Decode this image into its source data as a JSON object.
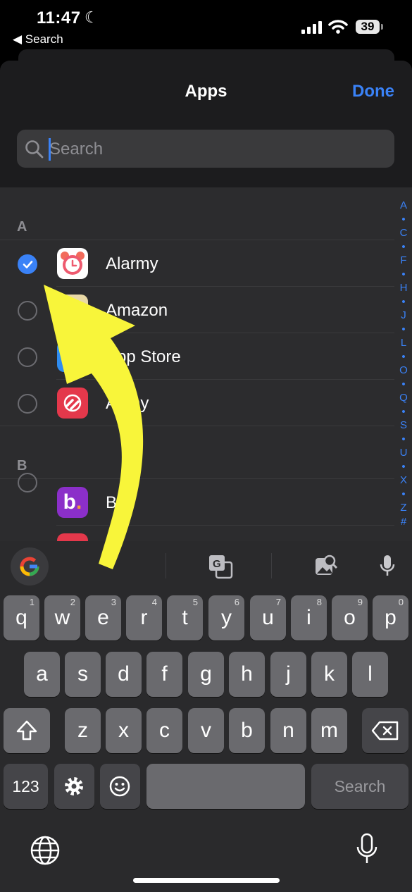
{
  "status_bar": {
    "time": "11:47",
    "back_label": "Search",
    "battery": "39"
  },
  "header": {
    "title": "Apps",
    "done_label": "Done"
  },
  "search": {
    "placeholder": "Search"
  },
  "sections": [
    {
      "letter": "A",
      "apps": [
        {
          "name": "Alarmy",
          "selected": true
        },
        {
          "name": "Amazon",
          "selected": false
        },
        {
          "name": "App Store",
          "selected": false
        },
        {
          "name": "Authy",
          "selected": false
        }
      ]
    },
    {
      "letter": "B",
      "apps": [
        {
          "name": "BN",
          "selected": false
        }
      ]
    }
  ],
  "index_letters": [
    "A",
    "•",
    "C",
    "•",
    "F",
    "•",
    "H",
    "•",
    "J",
    "•",
    "L",
    "•",
    "O",
    "•",
    "Q",
    "•",
    "S",
    "•",
    "U",
    "•",
    "X",
    "•",
    "Z",
    "#"
  ],
  "keyboard": {
    "row1": [
      [
        "q",
        "1"
      ],
      [
        "w",
        "2"
      ],
      [
        "e",
        "3"
      ],
      [
        "r",
        "4"
      ],
      [
        "t",
        "5"
      ],
      [
        "y",
        "6"
      ],
      [
        "u",
        "7"
      ],
      [
        "i",
        "8"
      ],
      [
        "o",
        "9"
      ],
      [
        "p",
        "0"
      ]
    ],
    "row2": [
      "a",
      "s",
      "d",
      "f",
      "g",
      "h",
      "j",
      "k",
      "l"
    ],
    "row3": [
      "z",
      "x",
      "c",
      "v",
      "b",
      "n",
      "m"
    ],
    "numbers_label": "123",
    "search_label": "Search"
  },
  "colors": {
    "accent": "#3a82f7",
    "arrow": "#f8f53a"
  }
}
